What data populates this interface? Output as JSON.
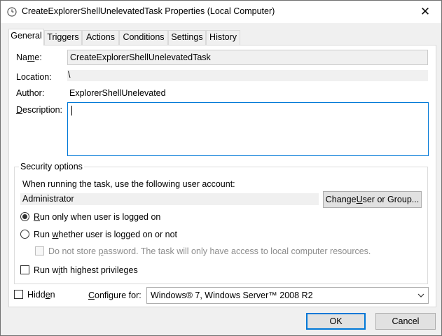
{
  "window": {
    "title": "CreateExplorerShellUnelevatedTask Properties (Local Computer)",
    "close_glyph": "✕"
  },
  "tabs": [
    {
      "label": "General",
      "active": true
    },
    {
      "label": "Triggers"
    },
    {
      "label": "Actions"
    },
    {
      "label": "Conditions"
    },
    {
      "label": "Settings"
    },
    {
      "label": "History"
    }
  ],
  "general": {
    "name_label_pre": "Na",
    "name_label_u": "m",
    "name_label_post": "e:",
    "name_value": "CreateExplorerShellUnelevatedTask",
    "location_label": "Location:",
    "location_value": "\\",
    "author_label": "Author:",
    "author_value": "ExplorerShellUnelevated",
    "description_label_pre": "",
    "description_label_u": "D",
    "description_label_post": "escription:",
    "description_value": ""
  },
  "security": {
    "group_title": "Security options",
    "account_prompt": "When running the task, use the following user account:",
    "account_value": "Administrator",
    "change_button_pre": "Change ",
    "change_button_u": "U",
    "change_button_post": "ser or Group...",
    "radio_logged_on_pre": "",
    "radio_logged_on_u": "R",
    "radio_logged_on_post": "un only when user is logged on",
    "radio_logged_on_selected": true,
    "radio_whether_pre": "Run ",
    "radio_whether_u": "w",
    "radio_whether_post": "hether user is logged on or not",
    "no_store_pre": "Do not store ",
    "no_store_u": "p",
    "no_store_post": "assword.  The task will only have access to local computer resources.",
    "highest_pre": "Run w",
    "highest_u": "i",
    "highest_post": "th highest privileges"
  },
  "bottom": {
    "hidden_pre": "Hidd",
    "hidden_u": "e",
    "hidden_post": "n",
    "configure_pre": "",
    "configure_u": "C",
    "configure_post": "onfigure for:",
    "configure_value": "Windows® 7, Windows Server™ 2008 R2"
  },
  "buttons": {
    "ok": "OK",
    "cancel": "Cancel"
  },
  "colors": {
    "accent": "#0078d7",
    "window_bg": "#f0f0f0",
    "panel_bg": "#ffffff"
  }
}
